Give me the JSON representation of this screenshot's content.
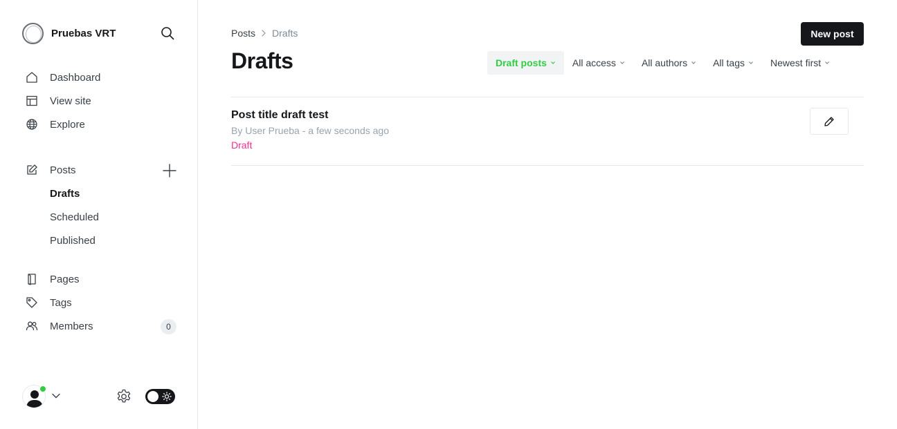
{
  "sidebar": {
    "brand_name": "Pruebas VRT",
    "nav": {
      "dashboard": "Dashboard",
      "view_site": "View site",
      "explore": "Explore",
      "posts": "Posts",
      "drafts": "Drafts",
      "scheduled": "Scheduled",
      "published": "Published",
      "pages": "Pages",
      "tags": "Tags",
      "members": "Members",
      "members_count": "0"
    }
  },
  "breadcrumb": {
    "parent": "Posts",
    "current": "Drafts"
  },
  "header": {
    "title": "Drafts",
    "new_post_label": "New post"
  },
  "filters": [
    {
      "label": "Draft posts",
      "active": true
    },
    {
      "label": "All access",
      "active": false
    },
    {
      "label": "All authors",
      "active": false
    },
    {
      "label": "All tags",
      "active": false
    },
    {
      "label": "Newest first",
      "active": false
    }
  ],
  "posts": [
    {
      "title": "Post title draft test",
      "meta": "By User Prueba - a few seconds ago",
      "status": "Draft"
    }
  ],
  "colors": {
    "accent_green": "#30cf43",
    "draft_pink": "#fb2d8d",
    "primary_dark": "#15171a"
  },
  "icons": {
    "search": "search-icon",
    "dashboard": "home-icon",
    "view_site": "layout-icon",
    "explore": "globe-icon",
    "posts": "edit-icon",
    "pages": "page-icon",
    "tags": "tag-icon",
    "members": "members-icon",
    "settings": "gear-icon",
    "theme": "sun-icon"
  }
}
